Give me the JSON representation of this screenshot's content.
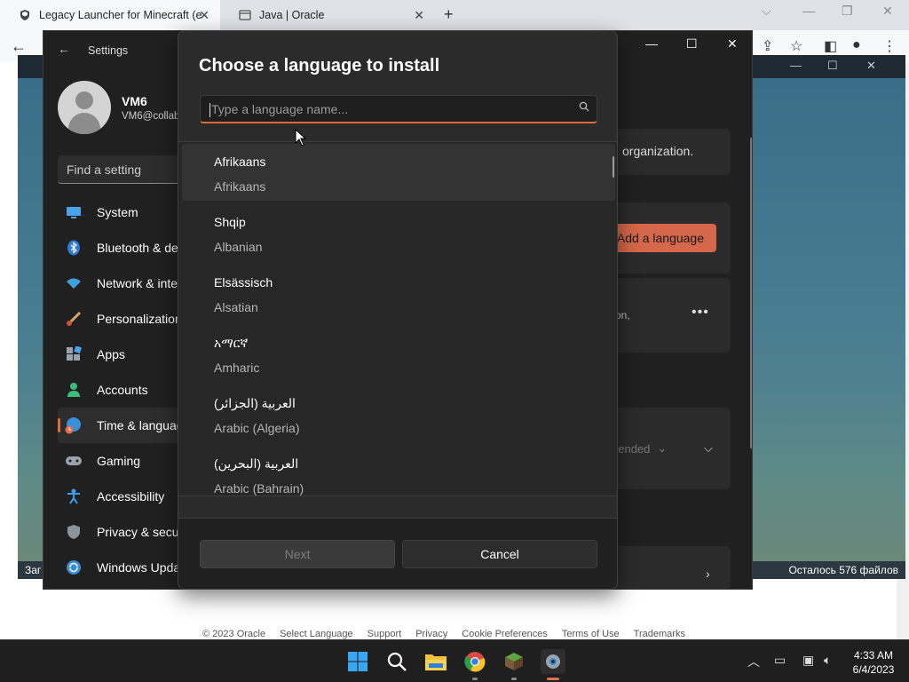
{
  "browser": {
    "tabs": [
      {
        "title": "Legacy Launcher for Minecraft (e",
        "active": true
      },
      {
        "title": "Java | Oracle",
        "active": false
      }
    ],
    "new_tab": "+",
    "footer_links": [
      "© 2023 Oracle",
      "Select Language",
      "Support",
      "Privacy",
      "Cookie Preferences",
      "Terms of Use",
      "Trademarks"
    ]
  },
  "launcher": {
    "status_left": "Заг",
    "status_right": "Осталось 576 файлов"
  },
  "settings": {
    "title": "Settings",
    "user": {
      "name": "VM6",
      "email": "VM6@collab"
    },
    "search_placeholder": "Find a setting",
    "nav": [
      {
        "label": "System",
        "icon": "monitor-icon"
      },
      {
        "label": "Bluetooth & devices",
        "icon": "bluetooth-icon"
      },
      {
        "label": "Network & internet",
        "icon": "wifi-icon"
      },
      {
        "label": "Personalization",
        "icon": "brush-icon"
      },
      {
        "label": "Apps",
        "icon": "apps-icon"
      },
      {
        "label": "Accounts",
        "icon": "person-icon"
      },
      {
        "label": "Time & language",
        "icon": "globe-clock-icon",
        "active": true
      },
      {
        "label": "Gaming",
        "icon": "gamepad-icon"
      },
      {
        "label": "Accessibility",
        "icon": "accessibility-icon"
      },
      {
        "label": "Privacy & security",
        "icon": "shield-icon"
      },
      {
        "label": "Windows Update",
        "icon": "update-icon"
      }
    ],
    "right": {
      "org_text": "organization.",
      "add_language": "Add a language",
      "partial_text": "on,",
      "more": "•••",
      "recommended": "nended"
    }
  },
  "dialog": {
    "title": "Choose a language to install",
    "search_placeholder": "Type a language name...",
    "languages": [
      {
        "native": "Afrikaans",
        "english": "Afrikaans",
        "selected": true
      },
      {
        "native": "Shqip",
        "english": "Albanian"
      },
      {
        "native": "Elsässisch",
        "english": "Alsatian"
      },
      {
        "native": "አማርኛ",
        "english": "Amharic"
      },
      {
        "native": "العربية (الجزائر)",
        "english": "Arabic (Algeria)"
      },
      {
        "native": "العربية (البحرين)",
        "english": "Arabic (Bahrain)"
      }
    ],
    "next_label": "Next",
    "cancel_label": "Cancel",
    "next_enabled": false
  },
  "taskbar": {
    "apps": [
      "windows-start-icon",
      "search-icon",
      "file-explorer-icon",
      "chrome-icon",
      "minecraft-icon",
      "settings-gear-icon"
    ],
    "time": "4:33 AM",
    "date": "6/4/2023"
  },
  "colors": {
    "accent": "#e26a3a",
    "add_button": "#d5674a",
    "settings_bg": "#202020",
    "dialog_bg": "#2b2b2b"
  }
}
